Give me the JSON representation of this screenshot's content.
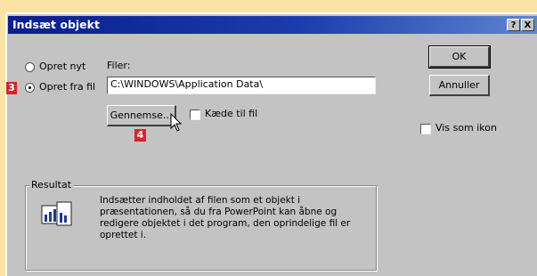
{
  "dialog": {
    "title": "Indsæt objekt",
    "help_label": "?",
    "close_label": "X"
  },
  "options": {
    "create_new": "Opret nyt",
    "create_from_file": "Opret fra fil",
    "files_label": "Filer:",
    "file_path_value": "C:\\WINDOWS\\Application Data\\",
    "browse_label": "Gennemse...",
    "link_label": "Kæde til fil",
    "selected": "create_from_file"
  },
  "buttons": {
    "ok": "OK",
    "cancel": "Annuller"
  },
  "display_as_icon_label": "Vis som ikon",
  "result": {
    "group_label": "Resultat",
    "text": "Indsætter indholdet af filen som et objekt i præsentationen, så du fra PowerPoint kan åbne og redigere objektet i det program, den oprindelige fil er oprettet i."
  },
  "step_badges": [
    "3",
    "4"
  ],
  "colors": {
    "page_background": "#fbe3a6",
    "titlebar_start": "#0a1e8c",
    "titlebar_end": "#5d86cf",
    "dialog_face": "#c3c3c3",
    "badge": "#d8232a"
  }
}
